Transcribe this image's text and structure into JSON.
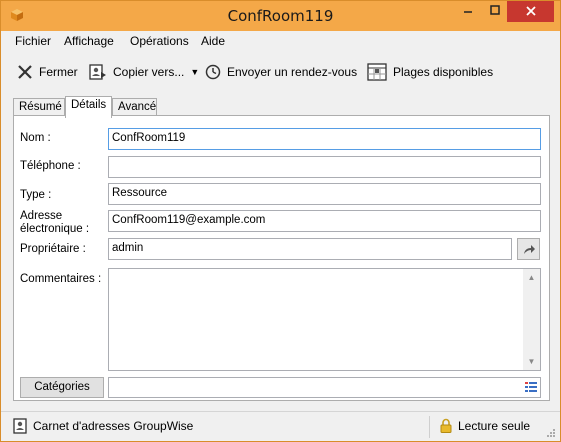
{
  "window": {
    "title": "ConfRoom119"
  },
  "menu": {
    "items": [
      "Fichier",
      "Affichage",
      "Opérations",
      "Aide"
    ]
  },
  "toolbar": {
    "close_label": "Fermer",
    "copy_label": "Copier vers...",
    "send_label": "Envoyer un rendez-vous",
    "ranges_label": "Plages disponibles"
  },
  "tabs": [
    "Résumé",
    "Détails",
    "Avancé"
  ],
  "form": {
    "name_label": "Nom :",
    "name_value": "ConfRoom119",
    "phone_label": "Téléphone :",
    "phone_value": "",
    "type_label": "Type :",
    "type_value": "Ressource",
    "email_label_1": "Adresse",
    "email_label_2": "électronique :",
    "email_value": "ConfRoom119@example.com",
    "owner_label": "Propriétaire :",
    "owner_value": "admin",
    "comments_label": "Commentaires :",
    "comments_value": "",
    "categories_button": "Catégories",
    "categories_value": ""
  },
  "status": {
    "address_book": "Carnet d'adresses GroupWise",
    "read_only": "Lecture seule"
  },
  "colors": {
    "title_bar": "#f4a848",
    "close_button": "#c7372f",
    "focus_border": "#569de5"
  }
}
